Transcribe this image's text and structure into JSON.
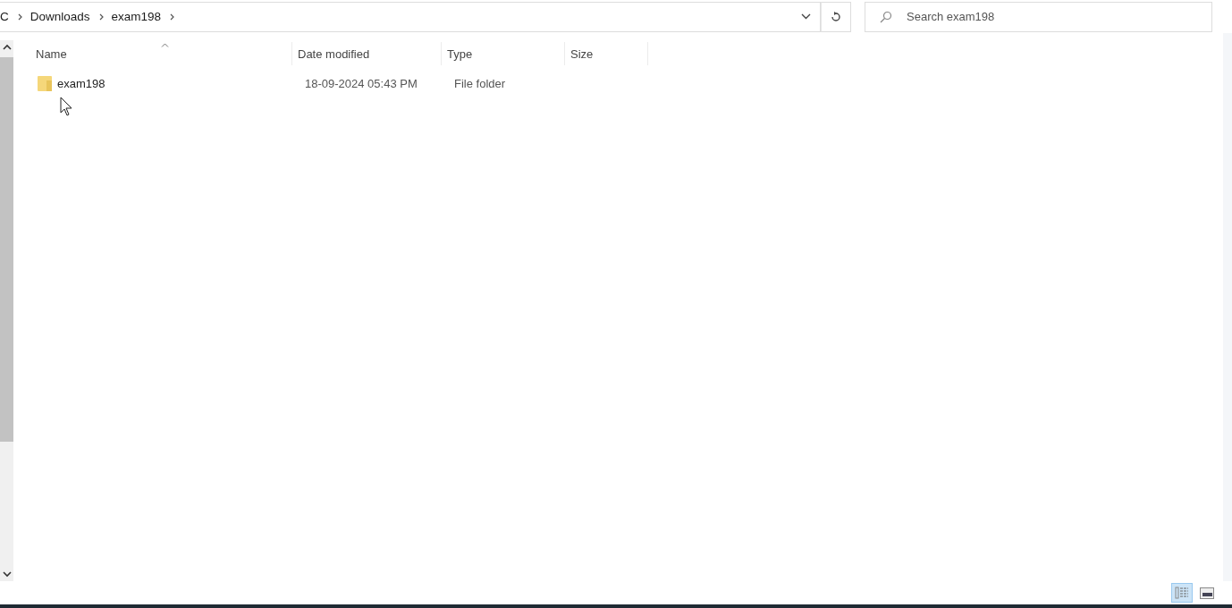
{
  "breadcrumb": [
    "C",
    "Downloads",
    "exam198"
  ],
  "search": {
    "placeholder": "Search exam198"
  },
  "columns": [
    {
      "label": "Name",
      "sorted": true
    },
    {
      "label": "Date modified",
      "sorted": false
    },
    {
      "label": "Type",
      "sorted": false
    },
    {
      "label": "Size",
      "sorted": false
    }
  ],
  "rows": [
    {
      "name": "exam198",
      "date_modified": "18-09-2024 05:43 PM",
      "type": "File folder"
    }
  ],
  "views": [
    {
      "kind": "details",
      "selected": true
    },
    {
      "kind": "tiles",
      "selected": false
    }
  ]
}
